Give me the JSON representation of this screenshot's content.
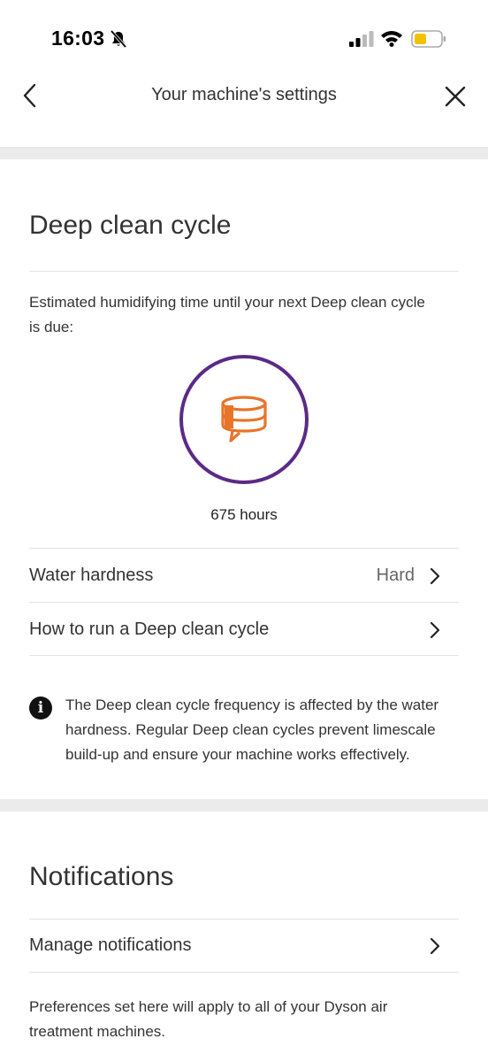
{
  "status_bar": {
    "time": "16:03"
  },
  "header": {
    "title": "Your machine's settings"
  },
  "deep_clean": {
    "title": "Deep clean cycle",
    "description": "Estimated humidifying time until your next Deep clean cycle is due:",
    "hours": "675 hours",
    "ring_color": "#5b2a86",
    "icon_color": "#e8742a"
  },
  "rows": [
    {
      "label": "Water hardness",
      "value": "Hard"
    },
    {
      "label": "How to run a Deep clean cycle",
      "value": ""
    }
  ],
  "info": {
    "text": "The Deep clean cycle frequency is affected by the water hardness. Regular Deep clean cycles prevent limescale build-up and ensure your machine works effectively."
  },
  "notifications": {
    "title": "Notifications",
    "manage_label": "Manage notifications",
    "note": "Preferences set here will apply to all of your Dyson air treatment machines."
  }
}
